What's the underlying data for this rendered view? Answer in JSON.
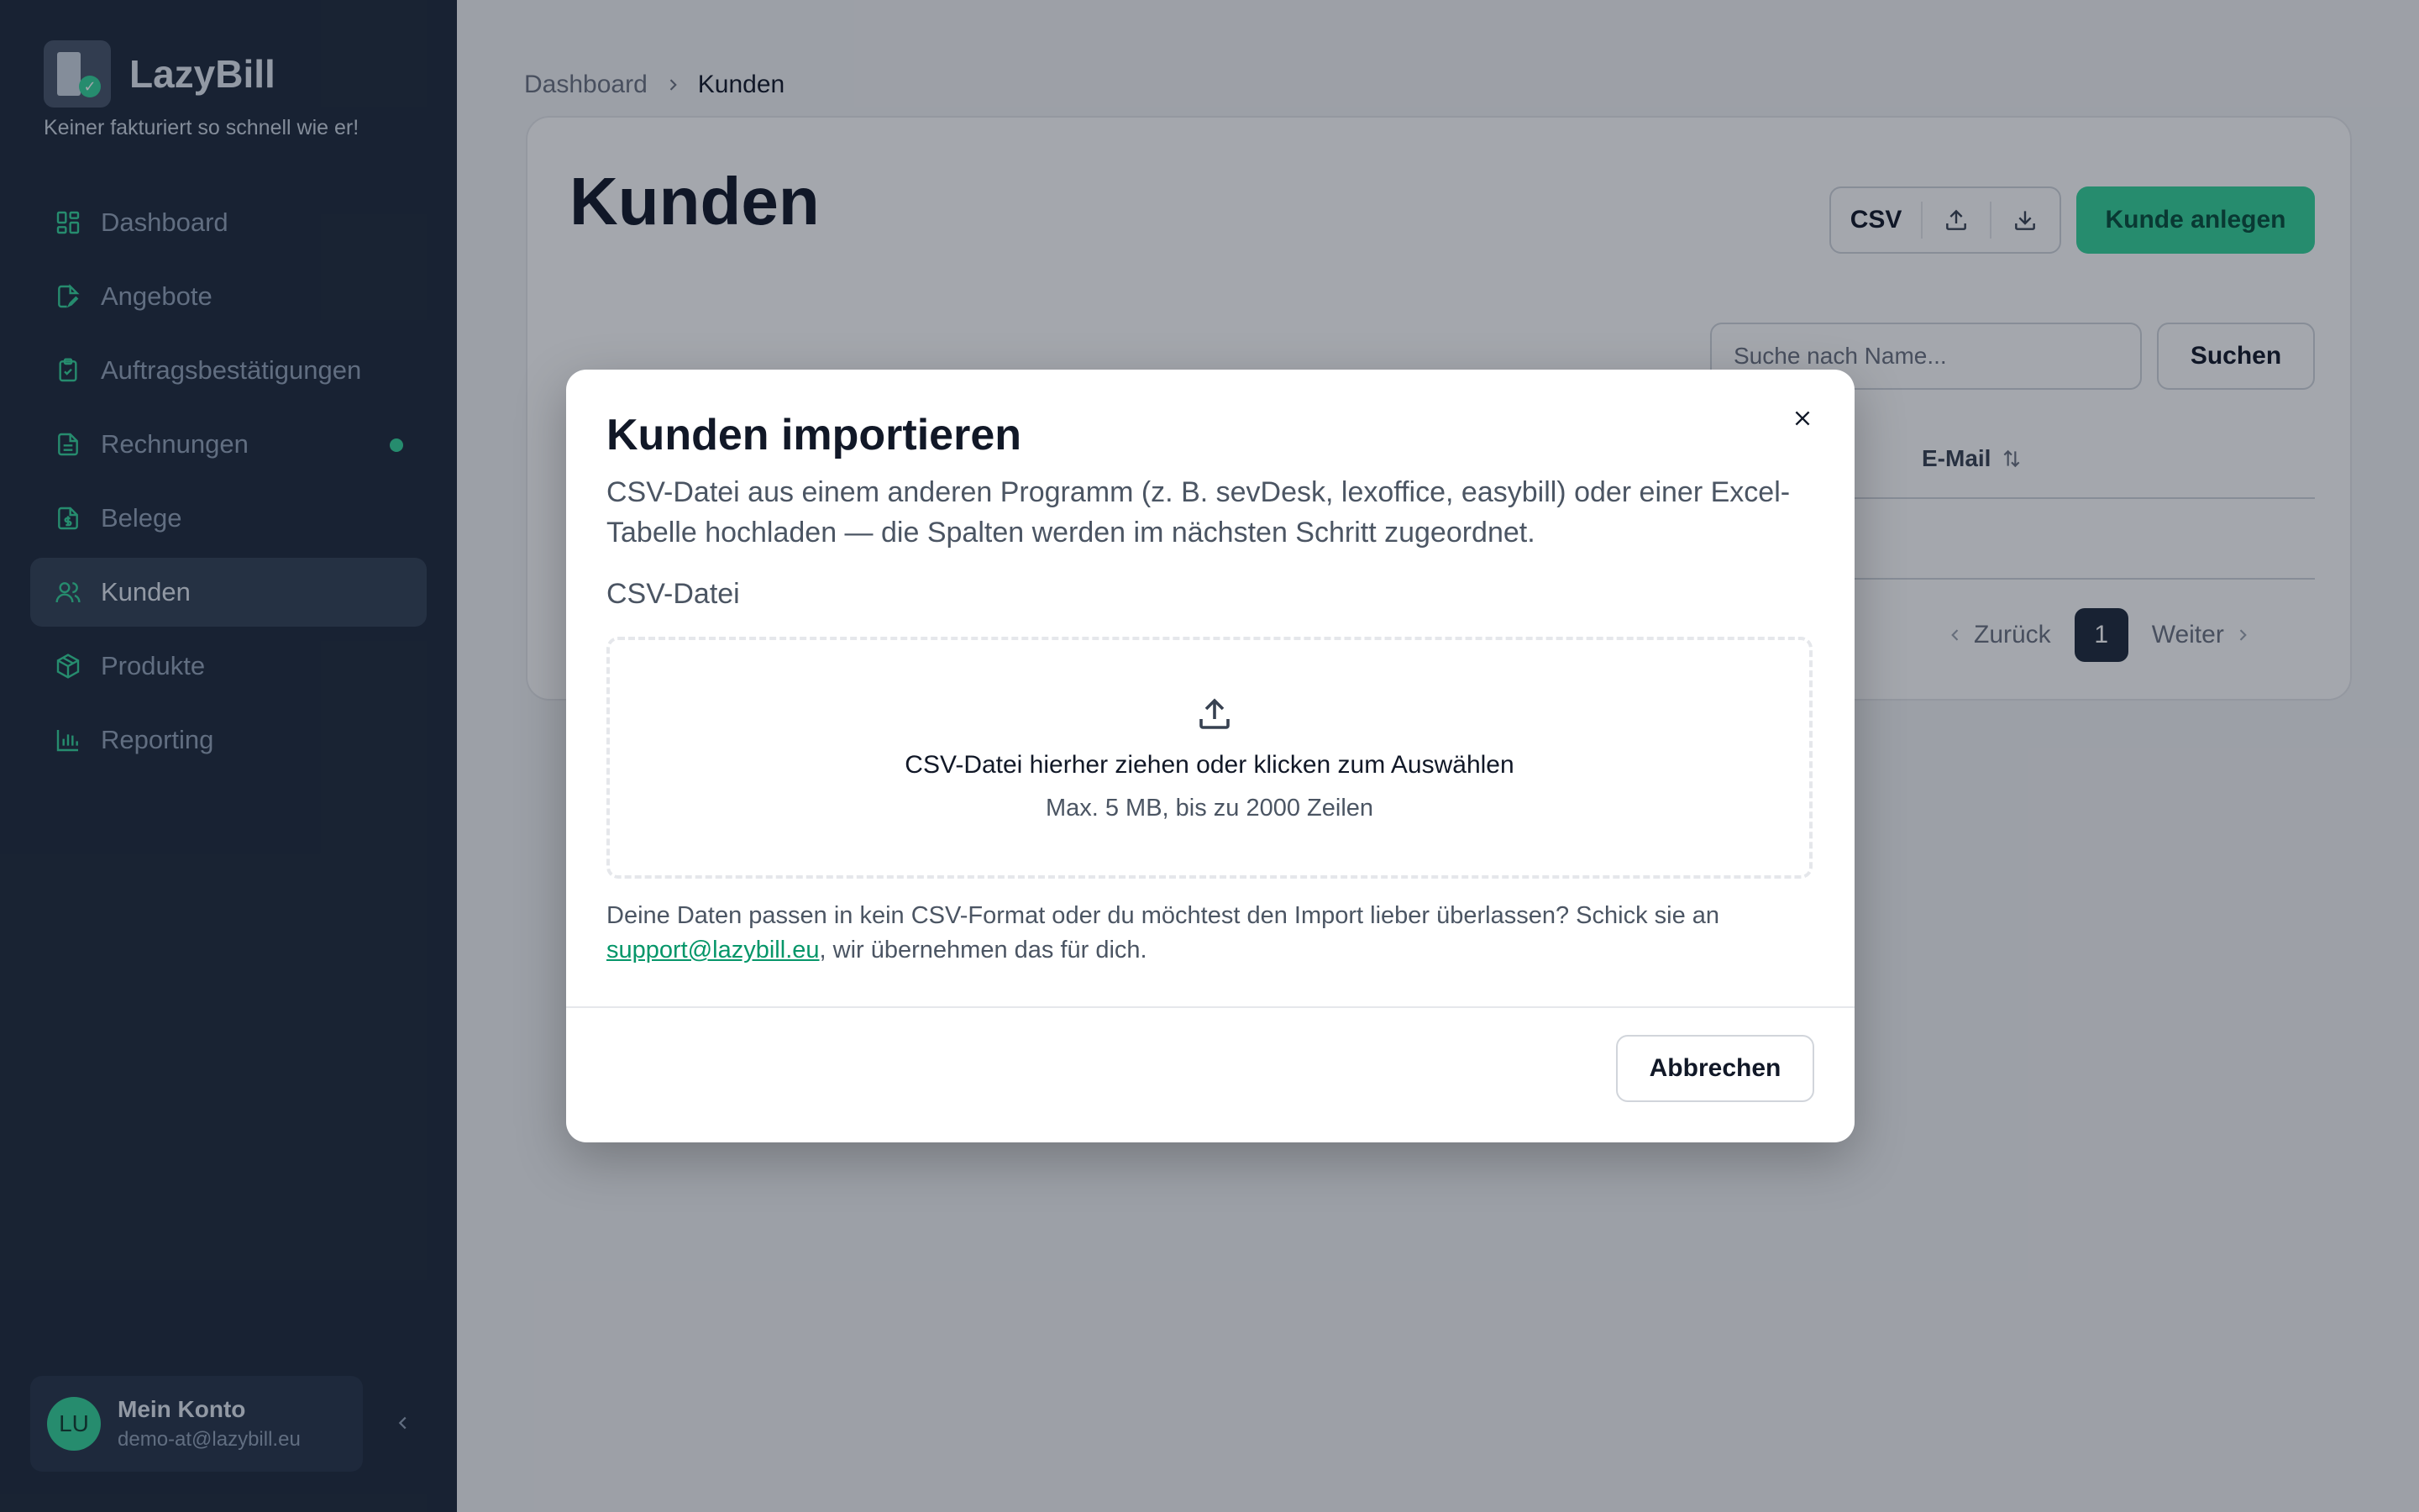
{
  "sidebar": {
    "brand_name": "LazyBill",
    "tagline": "Keiner fakturiert so schnell wie er!",
    "items": [
      {
        "label": "Dashboard",
        "icon": "dashboard-icon"
      },
      {
        "label": "Angebote",
        "icon": "document-edit-icon"
      },
      {
        "label": "Auftragsbestätigungen",
        "icon": "clipboard-check-icon"
      },
      {
        "label": "Rechnungen",
        "icon": "document-text-icon",
        "badge": true
      },
      {
        "label": "Belege",
        "icon": "receipt-icon"
      },
      {
        "label": "Kunden",
        "icon": "users-icon",
        "active": true
      },
      {
        "label": "Produkte",
        "icon": "box-icon"
      },
      {
        "label": "Reporting",
        "icon": "bar-chart-icon"
      }
    ],
    "account": {
      "initials": "LU",
      "name": "Mein Konto",
      "email": "demo-at@lazybill.eu"
    }
  },
  "breadcrumb": {
    "items": [
      "Dashboard",
      "Kunden"
    ]
  },
  "page": {
    "title": "Kunden",
    "csv_label": "CSV",
    "create_label": "Kunde anlegen",
    "search_placeholder": "Suche nach Name...",
    "search_label": "Suchen",
    "column_email": "E-Mail",
    "pager": {
      "prev": "Zurück",
      "current": "1",
      "next": "Weiter"
    }
  },
  "modal": {
    "title": "Kunden importieren",
    "description": "CSV-Datei aus einem anderen Programm (z. B. sevDesk, lexoffice, easybill) oder einer Excel-Tabelle hochladen — die Spalten werden im nächsten Schritt zugeordnet.",
    "field_label": "CSV-Datei",
    "dropzone_main": "CSV-Datei hierher ziehen oder klicken zum Auswählen",
    "dropzone_sub": "Max. 5 MB, bis zu 2000 Zeilen",
    "note_before": "Deine Daten passen in kein CSV-Format oder du möchtest den Import lieber überlassen? Schick sie an ",
    "note_link": "support@lazybill.eu",
    "note_after": ", wir übernehmen das für dich.",
    "cancel_label": "Abbrechen"
  },
  "colors": {
    "sidebar_bg": "#1e293b",
    "accent": "#34d399",
    "link": "#059669"
  }
}
